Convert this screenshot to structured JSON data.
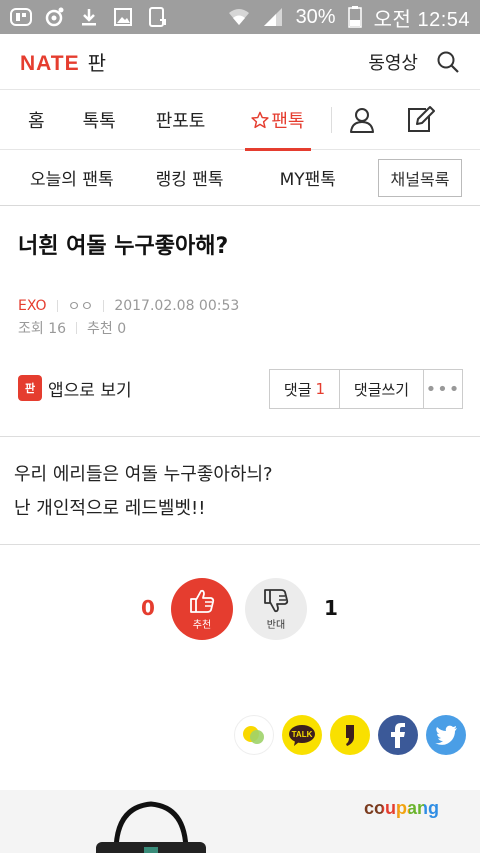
{
  "status_bar": {
    "battery": "30%",
    "time": "오전 12:54",
    "icons": [
      "app-notification-icon",
      "settings-notification-icon",
      "download-icon",
      "image-icon",
      "screenshot-icon",
      "wifi-icon",
      "signal-icon",
      "battery-icon"
    ]
  },
  "header": {
    "logo_brand": "NATE",
    "logo_service": "판",
    "video_link": "동영상",
    "search_icon": "search-icon"
  },
  "main_tabs": [
    {
      "label": "홈"
    },
    {
      "label": "톡톡"
    },
    {
      "label": "판포토"
    },
    {
      "label": "팬톡",
      "active": true
    }
  ],
  "sub_tabs": {
    "items": [
      "오늘의 팬톡",
      "랭킹 팬톡",
      "MY팬톡"
    ],
    "channel_button": "채널목록"
  },
  "post": {
    "title": "너흰 여돌 누구좋아해?",
    "category": "EXO",
    "author": "ㅇㅇ",
    "date": "2017.02.08 00:53",
    "views": "조회 16",
    "recommends": "추천 0",
    "app_badge": "판",
    "app_view": "앱으로 보기",
    "comment_label": "댓글",
    "comment_count": "1",
    "write_comment": "댓글쓰기",
    "more": "•••",
    "content_line1": "우리 에리들은 여돌 누구좋아하늬?",
    "content_line2": "난 개인적으로 레드벨벳!!"
  },
  "votes": {
    "up_count": "0",
    "up_label": "추천",
    "down_label": "반대",
    "down_count": "1"
  },
  "share": {
    "talk_label": "TALK",
    "icons": [
      "kakaostory-icon",
      "kakaotalk-icon",
      "kakaopage-icon",
      "facebook-icon",
      "twitter-icon"
    ]
  },
  "ad": {
    "brand": "coupang"
  },
  "colors": {
    "accent": "#e53d2f",
    "status_bar": "#9e9e9e",
    "facebook": "#3b5998",
    "twitter": "#4a9ee6",
    "kakao": "#f9e000"
  }
}
